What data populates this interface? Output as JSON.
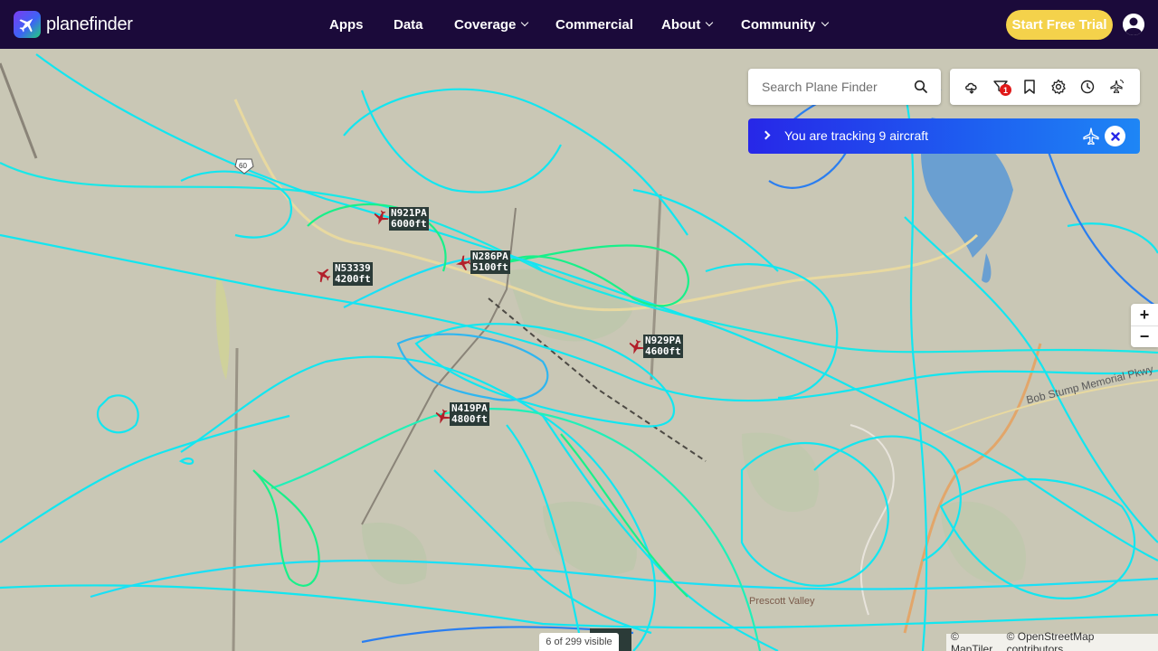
{
  "header": {
    "logo_text": "planefinder",
    "nav": [
      {
        "label": "Apps",
        "has_dropdown": false
      },
      {
        "label": "Data",
        "has_dropdown": false
      },
      {
        "label": "Coverage",
        "has_dropdown": true
      },
      {
        "label": "Commercial",
        "has_dropdown": false
      },
      {
        "label": "About",
        "has_dropdown": true
      },
      {
        "label": "Community",
        "has_dropdown": true
      }
    ],
    "cta_label": "Start Free Trial",
    "account_icon": "user-circle-icon"
  },
  "search": {
    "placeholder": "Search Plane Finder",
    "icon": "search-icon"
  },
  "toolbar": {
    "tools": [
      "weather-cloud-icon",
      "filter-icon",
      "bookmark-icon",
      "settings-gear-icon",
      "history-clock-icon",
      "playback-plane-icon"
    ],
    "filter_badge": "1"
  },
  "tracking": {
    "text": "You are tracking 9 aircraft"
  },
  "aircraft": [
    {
      "callsign": "N921PA",
      "altitude": "6000ft"
    },
    {
      "callsign": "N286PA",
      "altitude": "5100ft"
    },
    {
      "callsign": "N53339",
      "altitude": "4200ft"
    },
    {
      "callsign": "N929PA",
      "altitude": "4600ft"
    },
    {
      "callsign": "N419PA",
      "altitude": "4800ft"
    }
  ],
  "map_labels": {
    "road": "Bob Stump Memorial Pkwy",
    "town": "Prescott Valley",
    "route_shield": "60"
  },
  "zoom": {
    "in": "+",
    "out": "−"
  },
  "status": {
    "visible": "6 of 299 visible"
  },
  "attribution": {
    "maptiler": "© MapTiler",
    "osm": "© OpenStreetMap contributors"
  },
  "colors": {
    "nav_bg": "#1b0a3a",
    "cta": "#f4d24b",
    "track_cyan": "#12e6f0",
    "track_green": "#18f08a",
    "aircraft": "#b21f2a",
    "tracking_bar": "#2727e8"
  }
}
